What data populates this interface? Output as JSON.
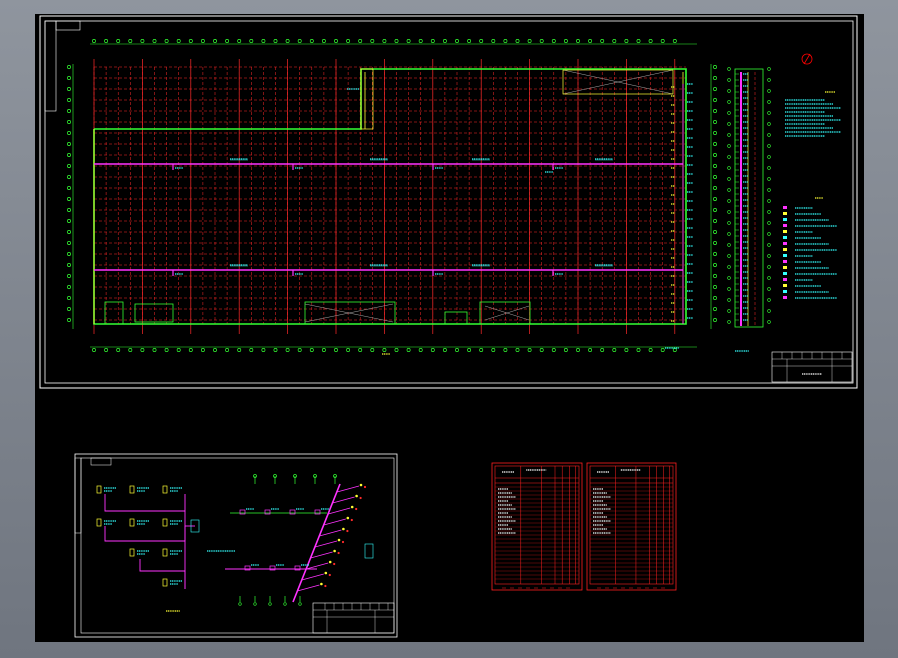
{
  "drawing": {
    "background": "#000000",
    "colors": {
      "frame": "#ffffff",
      "grid": "#ff2a2a",
      "outline": "#33ff33",
      "pipe": "#ff33ff",
      "text": "#33ffff",
      "yellow": "#ffff33",
      "table": "#ff2020",
      "north_marker": "#ff0000"
    },
    "icons": [
      "north-arrow-icon"
    ]
  }
}
